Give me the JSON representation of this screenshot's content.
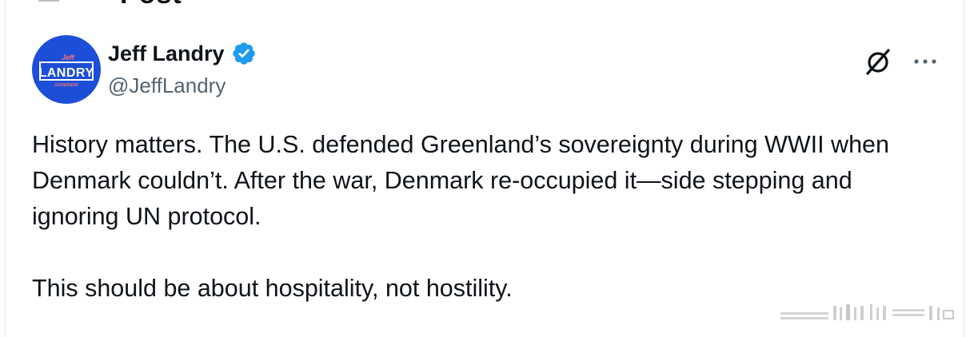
{
  "header_fragment": "Post",
  "tweet": {
    "author": {
      "display_name": "Jeff Landry",
      "handle": "@JeffLandry",
      "verified": true,
      "avatar": {
        "top_text": "Jeff",
        "main_text": "LANDRY",
        "bottom_text": "GOVERNOR",
        "background_color": "#1d4ed8"
      }
    },
    "paragraphs": [
      "History matters. The U.S. defended Greenland’s sovereignty during WWII when Denmark couldn’t. After the war, Denmark re-occupied it—side stepping and ignoring UN protocol.",
      "This should be about hospitality, not hostility."
    ]
  },
  "icons": {
    "verified": "verified-badge-icon",
    "grok": "grok-icon",
    "more": "more-options-icon"
  },
  "colors": {
    "text_primary": "#0f1419",
    "text_secondary": "#536471",
    "verified_blue": "#1d9bf0",
    "avatar_blue": "#1d4ed8"
  }
}
